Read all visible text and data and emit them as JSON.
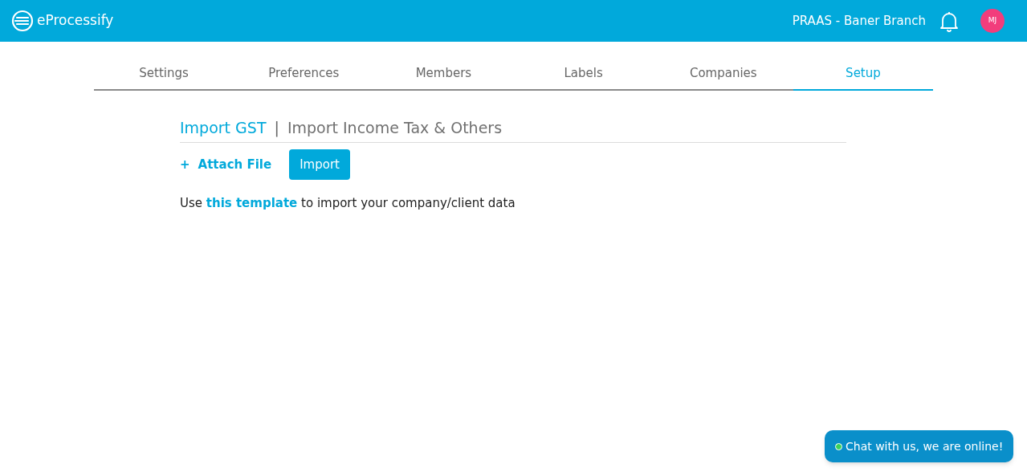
{
  "header": {
    "logo": "eProcessify",
    "branch": "PRAAS - Baner Branch",
    "avatar": "MJ"
  },
  "tabs": [
    {
      "label": "Settings",
      "selected": false
    },
    {
      "label": "Preferences",
      "selected": false
    },
    {
      "label": "Members",
      "selected": false
    },
    {
      "label": "Labels",
      "selected": false
    },
    {
      "label": "Companies",
      "selected": false
    },
    {
      "label": "Setup",
      "selected": true
    }
  ],
  "import_tabs": [
    {
      "label": "Import GST",
      "selected": true
    },
    {
      "label": "Import Income Tax & Others",
      "selected": false
    }
  ],
  "import_tabs_separator": "|",
  "attach_file": {
    "icon": "+",
    "label": "Attach File"
  },
  "import_button": "Import",
  "template_note": {
    "before": "Use",
    "link": "this template",
    "after": "to import your company/client data"
  },
  "chat": {
    "label": "Chat with us, we are online!",
    "online": true
  }
}
